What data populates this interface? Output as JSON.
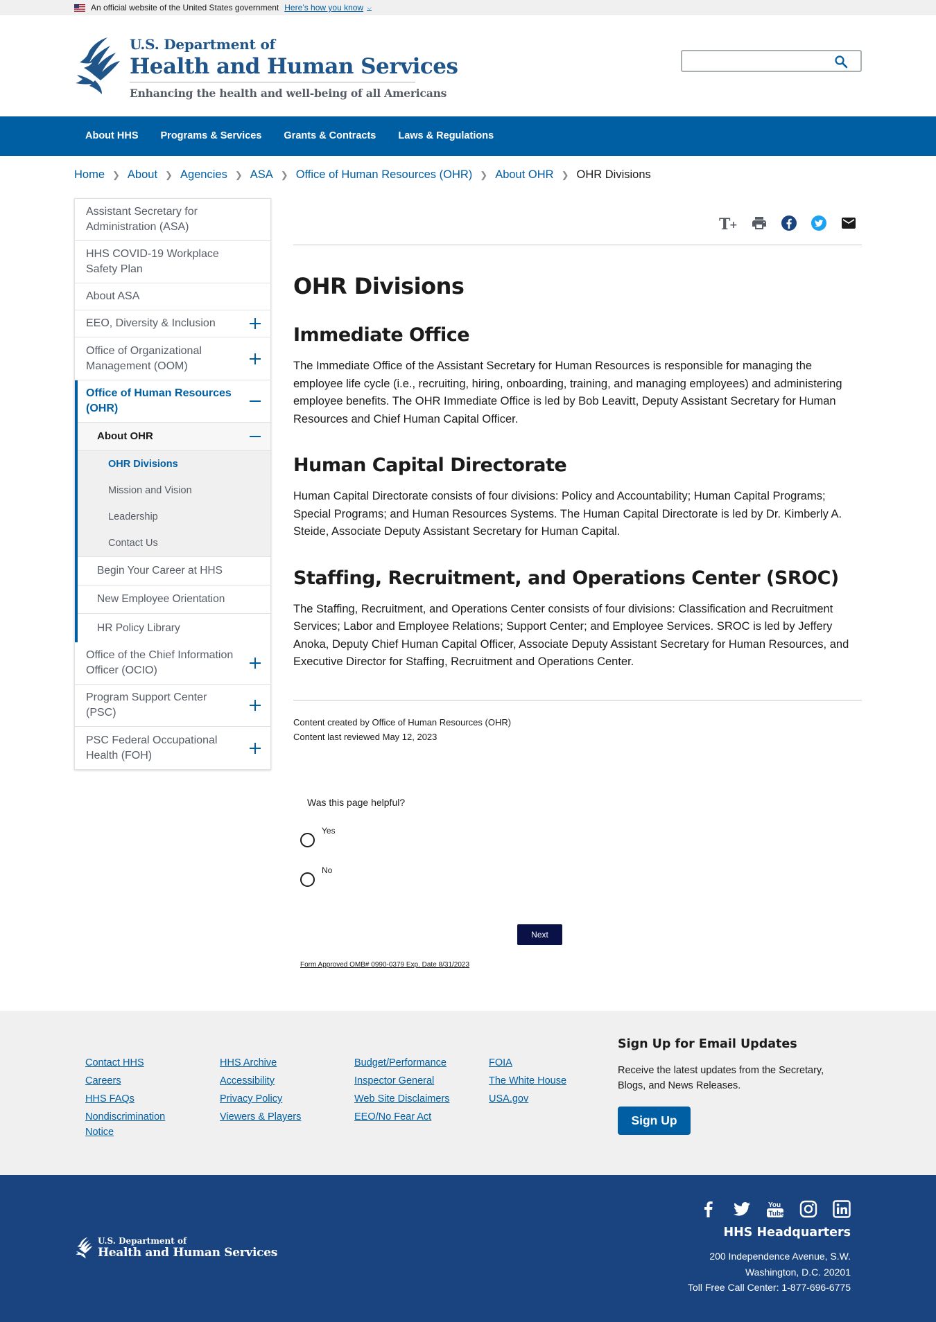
{
  "banner": {
    "text": "An official website of the United States government",
    "link": "Here’s how you know"
  },
  "header": {
    "logo_line1": "U.S. Department of",
    "logo_line2": "Health and Human Services",
    "tagline": "Enhancing the health and well-being of all Americans",
    "search_placeholder": ""
  },
  "nav": [
    "About HHS",
    "Programs & Services",
    "Grants & Contracts",
    "Laws & Regulations"
  ],
  "breadcrumb": {
    "items": [
      "Home",
      "About",
      "Agencies",
      "ASA",
      "Office of Human Resources (OHR)",
      "About OHR"
    ],
    "current": "OHR Divisions"
  },
  "sidebar": {
    "items": [
      "Assistant Secretary for Administration (ASA)",
      "HHS COVID-19 Workplace Safety Plan",
      "About ASA",
      "EEO, Diversity & Inclusion",
      "Office of Organizational Management (OOM)"
    ],
    "active": "Office of Human Resources (OHR)",
    "active_sub": "About OHR",
    "level3": [
      "OHR Divisions",
      "Mission and Vision",
      "Leadership",
      "Contact Us"
    ],
    "level2": [
      "Begin Your Career at HHS",
      "New Employee Orientation",
      "HR Policy Library"
    ],
    "after": [
      "Office of the Chief Information Officer (OCIO)",
      "Program Support Center (PSC)",
      "PSC Federal Occupational Health (FOH)"
    ]
  },
  "content": {
    "title": "OHR Divisions",
    "sections": [
      {
        "heading": "Immediate Office",
        "body": "The Immediate Office of the Assistant Secretary for Human Resources is responsible for managing the employee life cycle (i.e., recruiting, hiring, onboarding, training, and managing employees) and administering employee benefits. The OHR Immediate Office is led by Bob Leavitt, Deputy Assistant Secretary for Human Resources and Chief Human Capital Officer."
      },
      {
        "heading": "Human Capital Directorate",
        "body": "Human Capital Directorate consists of four divisions: Policy and Accountability; Human Capital Programs; Special Programs; and Human Resources Systems. The Human Capital Directorate is led by Dr. Kimberly A. Steide, Associate Deputy Assistant Secretary for Human Capital."
      },
      {
        "heading": "Staffing, Recruitment, and Operations Center (SROC)",
        "body": "The Staffing, Recruitment, and Operations Center consists of four divisions: Classification and Recruitment Services; Labor and Employee Relations; Support Center; and Employee Services. SROC is led by Jeffery Anoka, Deputy Chief Human Capital Officer, Associate Deputy Assistant Secretary for Human Resources, and Executive Director for Staffing, Recruitment and Operations Center."
      }
    ],
    "created": "Content created by Office of Human Resources (OHR)",
    "reviewed": "Content last reviewed May 12, 2023"
  },
  "feedback": {
    "question": "Was this page helpful?",
    "yes": "Yes",
    "no": "No",
    "next": "Next",
    "omb": "Form Approved OMB# 0990-0379 Exp. Date 8/31/2023"
  },
  "footer": {
    "col1": [
      "Contact HHS",
      "Careers",
      "HHS FAQs",
      "Nondiscrimination Notice"
    ],
    "col2": [
      "HHS Archive",
      "Accessibility",
      "Privacy Policy",
      "Viewers & Players"
    ],
    "col3": [
      "Budget/Performance",
      "Inspector General",
      "Web Site Disclaimers",
      "EEO/No Fear Act"
    ],
    "col4": [
      "FOIA",
      "The White House",
      "USA.gov"
    ],
    "signup_title": "Sign Up for Email Updates",
    "signup_text": "Receive the latest updates from the Secretary, Blogs, and News Releases.",
    "signup_button": "Sign Up",
    "logo_line1": "U.S. Department of",
    "logo_line2": "Health and Human Services",
    "hq_title": "HHS Headquarters",
    "hq_addr1": "200 Independence Avenue, S.W.",
    "hq_addr2": "Washington, D.C. 20201",
    "hq_phone": "Toll Free Call Center: 1-877-696-6775"
  },
  "colors": {
    "primary": "#005ea2",
    "footer_dark": "#1a4480",
    "footer_light": "#f0f0f0",
    "next_button": "#0a1147"
  }
}
